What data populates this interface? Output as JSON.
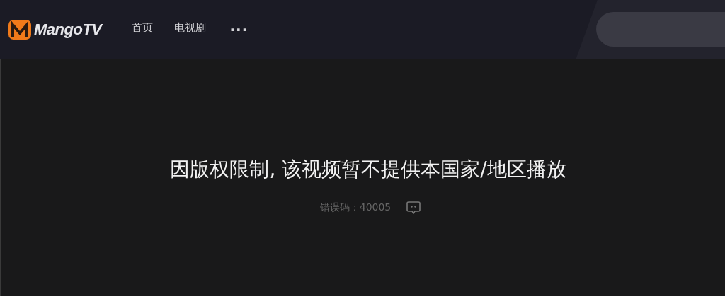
{
  "header": {
    "logo": "MangoTV",
    "nav": [
      {
        "label": "首页"
      },
      {
        "label": "电视剧"
      },
      {
        "label": "···"
      }
    ]
  },
  "player": {
    "message": "因版权限制, 该视频暂不提供本国家/地区播放",
    "error_code": "错误码：40005"
  }
}
